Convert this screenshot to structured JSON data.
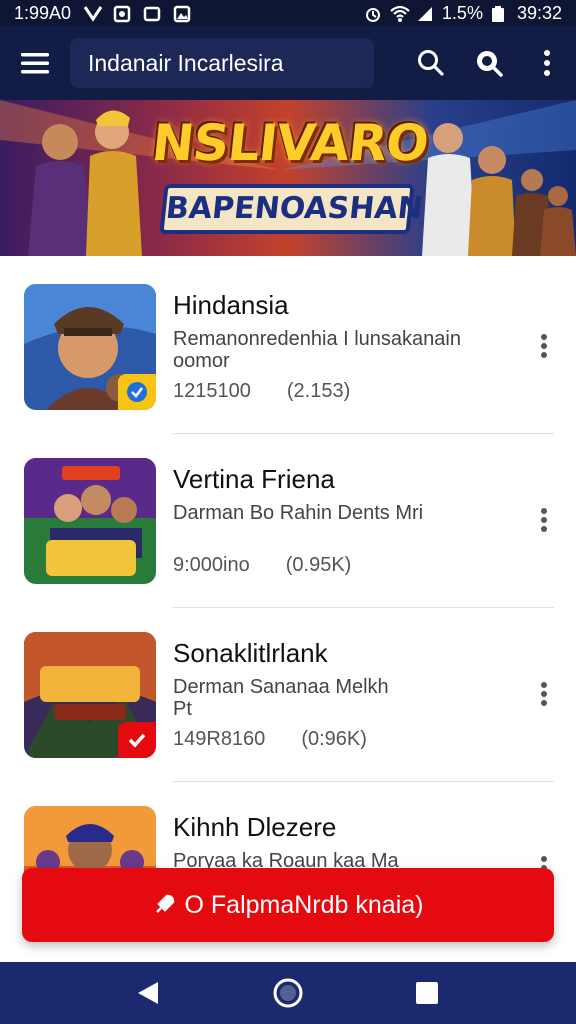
{
  "status_bar": {
    "time": "1:99A0",
    "battery": "1.5%",
    "clock": "39:32"
  },
  "app_bar": {
    "search_text": "Indanair Incarlesira",
    "icons": [
      "menu-icon",
      "search-icon",
      "search-alt-icon",
      "more-vertical-icon"
    ]
  },
  "banner": {
    "title": "NSLIVARO",
    "subtitle": "BAPENOASHAN"
  },
  "list": [
    {
      "title": "Hindansia",
      "desc_line1": "Remanonredenhia I lunsakanain",
      "desc_line2": "oomor",
      "count": "1215100",
      "size": "(2.153)",
      "badge": "check-blue",
      "badge_color": "#f6c415"
    },
    {
      "title": "Vertina Friena",
      "desc_line1": "Darman Bo Rahin Dents Mri",
      "desc_line2": "",
      "count": "9:000ino",
      "size": "(0.95K)",
      "badge": "",
      "badge_color": ""
    },
    {
      "title": "Sonaklitlrlank",
      "desc_line1": "Derman Sananaa Melkh",
      "desc_line2": "Pt",
      "count": "149R8160",
      "size": "(0:96K)",
      "badge": "check-white",
      "badge_color": "#e50a0f"
    },
    {
      "title": "Kihnh Dlezere",
      "desc_line1": "Poryaa ka Roaun kaa Ma",
      "desc_line2": "",
      "count": "",
      "size": "",
      "badge": "",
      "badge_color": ""
    }
  ],
  "cta": {
    "label": "O FalpmaNrdb knaia)"
  },
  "nav": [
    "back-icon",
    "home-icon",
    "recents-icon"
  ]
}
